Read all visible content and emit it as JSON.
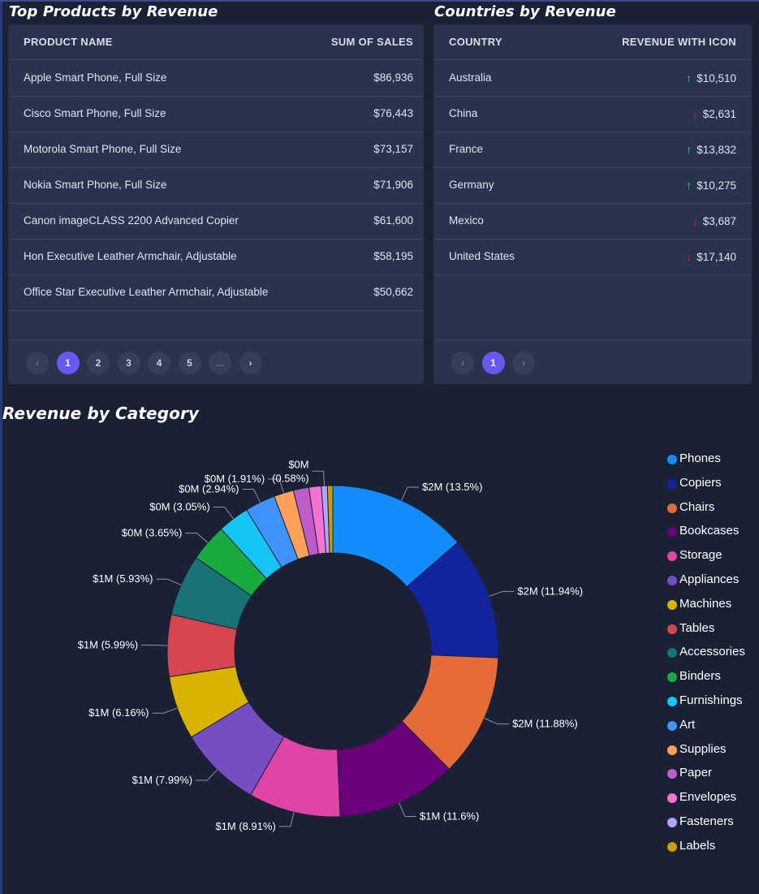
{
  "products": {
    "title": "Top Products by Revenue",
    "col1": "PRODUCT NAME",
    "col2": "SUM OF SALES",
    "rows": [
      {
        "name": "Apple Smart Phone, Full Size",
        "sales": "$86,936"
      },
      {
        "name": "Cisco Smart Phone, Full Size",
        "sales": "$76,443"
      },
      {
        "name": "Motorola Smart Phone, Full Size",
        "sales": "$73,157"
      },
      {
        "name": "Nokia Smart Phone, Full Size",
        "sales": "$71,906"
      },
      {
        "name": "Canon imageCLASS 2200 Advanced Copier",
        "sales": "$61,600"
      },
      {
        "name": "Hon Executive Leather Armchair, Adjustable",
        "sales": "$58,195"
      },
      {
        "name": "Office Star Executive Leather Armchair, Adjustable",
        "sales": "$50,662"
      }
    ],
    "pager": {
      "prev": "‹",
      "pages": [
        "1",
        "2",
        "3",
        "4",
        "5"
      ],
      "ellipsis": "...",
      "next": "›",
      "current": "1"
    }
  },
  "countries": {
    "title": "Countries by Revenue",
    "col1": "COUNTRY",
    "col2": "REVENUE WITH ICON",
    "rows": [
      {
        "country": "Australia",
        "revenue": "$10,510",
        "trend": "up"
      },
      {
        "country": "China",
        "revenue": "$2,631",
        "trend": "down"
      },
      {
        "country": "France",
        "revenue": "$13,832",
        "trend": "up"
      },
      {
        "country": "Germany",
        "revenue": "$10,275",
        "trend": "up"
      },
      {
        "country": "Mexico",
        "revenue": "$3,687",
        "trend": "down"
      },
      {
        "country": "United States",
        "revenue": "$17,140",
        "trend": "down"
      }
    ],
    "arrows": {
      "up": "↑",
      "down": "↓"
    },
    "colors": {
      "up": "#5cd36e",
      "down": "#e0252e"
    },
    "pager": {
      "prev": "‹",
      "pages": [
        "1"
      ],
      "next": "›",
      "current": "1"
    }
  },
  "chart_data": {
    "type": "pie",
    "title": "Revenue by Category",
    "donut": true,
    "legend_position": "right",
    "slices": [
      {
        "category": "Phones",
        "share": 13.5,
        "label": "$2M (13.5%)",
        "color": "#118dff"
      },
      {
        "category": "Copiers",
        "share": 11.94,
        "label": "$2M (11.94%)",
        "color": "#12239e"
      },
      {
        "category": "Chairs",
        "share": 11.88,
        "label": "$2M (11.88%)",
        "color": "#e66c37"
      },
      {
        "category": "Bookcases",
        "share": 11.6,
        "label": "$1M (11.6%)",
        "color": "#6b007b"
      },
      {
        "category": "Storage",
        "share": 8.91,
        "label": "$1M (8.91%)",
        "color": "#e044a7"
      },
      {
        "category": "Appliances",
        "share": 7.99,
        "label": "$1M (7.99%)",
        "color": "#744ec2"
      },
      {
        "category": "Machines",
        "share": 6.16,
        "label": "$1M (6.16%)",
        "color": "#d9b300"
      },
      {
        "category": "Tables",
        "share": 5.99,
        "label": "$1M (5.99%)",
        "color": "#d64550"
      },
      {
        "category": "Accessories",
        "share": 5.93,
        "label": "$1M (5.93%)",
        "color": "#197278"
      },
      {
        "category": "Binders",
        "share": 3.65,
        "label": "$0M (3.65%)",
        "color": "#1aab40"
      },
      {
        "category": "Furnishings",
        "share": 3.05,
        "label": "$0M (3.05%)",
        "color": "#15c6f4"
      },
      {
        "category": "Art",
        "share": 2.94,
        "label": "$0M (2.94%)",
        "color": "#4092ff"
      },
      {
        "category": "Supplies",
        "share": 1.91,
        "label": "$0M (1.91%)",
        "color": "#ffa058"
      },
      {
        "category": "Paper",
        "share": 1.5,
        "label": "",
        "color": "#be5dc9"
      },
      {
        "category": "Envelopes",
        "share": 1.2,
        "label": "",
        "color": "#f472d0"
      },
      {
        "category": "Fasteners",
        "share": 0.58,
        "label": "$0M\n(0.58%)",
        "color": "#b5a1ff"
      },
      {
        "category": "Labels",
        "share": 0.52,
        "label": "",
        "color": "#c4a200"
      }
    ]
  }
}
